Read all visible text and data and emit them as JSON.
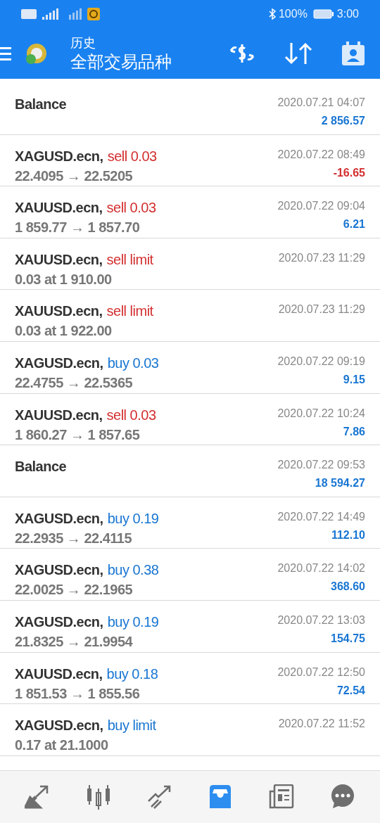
{
  "status_bar": {
    "battery": "100%",
    "time": "3:00"
  },
  "header": {
    "title": "历史",
    "subtitle": "全部交易品种"
  },
  "rows": [
    {
      "kind": "balance",
      "title": "Balance",
      "time": "2020.07.21 04:07",
      "profit": {
        "text": "2 856.57",
        "color": "#1976d2"
      }
    },
    {
      "kind": "trade",
      "title": "XAGUSD.ecn,",
      "action": {
        "text": "sell 0.03",
        "color": "#d32f2f"
      },
      "detail": "22.4095 → 22.5205",
      "time": "2020.07.22 08:49",
      "profit": {
        "text": "-16.65",
        "color": "#d32f2f"
      }
    },
    {
      "kind": "trade",
      "title": "XAUUSD.ecn,",
      "action": {
        "text": "sell 0.03",
        "color": "#d32f2f"
      },
      "detail": "1 859.77 → 1 857.70",
      "time": "2020.07.22 09:04",
      "profit": {
        "text": "6.21",
        "color": "#1976d2"
      }
    },
    {
      "kind": "trade",
      "title": "XAUUSD.ecn,",
      "action": {
        "text": "sell limit",
        "color": "#d32f2f"
      },
      "detail": "0.03 at 1 910.00",
      "time": "2020.07.23 11:29"
    },
    {
      "kind": "trade",
      "title": "XAUUSD.ecn,",
      "action": {
        "text": "sell limit",
        "color": "#d32f2f"
      },
      "detail": "0.03 at 1 922.00",
      "time": "2020.07.23 11:29"
    },
    {
      "kind": "trade",
      "title": "XAGUSD.ecn,",
      "action": {
        "text": "buy 0.03",
        "color": "#1976d2"
      },
      "detail": "22.4755 → 22.5365",
      "time": "2020.07.22 09:19",
      "profit": {
        "text": "9.15",
        "color": "#1976d2"
      }
    },
    {
      "kind": "trade",
      "title": "XAUUSD.ecn,",
      "action": {
        "text": "sell 0.03",
        "color": "#d32f2f"
      },
      "detail": "1 860.27 → 1 857.65",
      "time": "2020.07.22 10:24",
      "profit": {
        "text": "7.86",
        "color": "#1976d2"
      }
    },
    {
      "kind": "balance",
      "title": "Balance",
      "time": "2020.07.22 09:53",
      "profit": {
        "text": "18 594.27",
        "color": "#1976d2"
      }
    },
    {
      "kind": "trade",
      "title": "XAGUSD.ecn,",
      "action": {
        "text": "buy 0.19",
        "color": "#1976d2"
      },
      "detail": "22.2935 → 22.4115",
      "time": "2020.07.22 14:49",
      "profit": {
        "text": "112.10",
        "color": "#1976d2"
      }
    },
    {
      "kind": "trade",
      "title": "XAGUSD.ecn,",
      "action": {
        "text": "buy 0.38",
        "color": "#1976d2"
      },
      "detail": "22.0025 → 22.1965",
      "time": "2020.07.22 14:02",
      "profit": {
        "text": "368.60",
        "color": "#1976d2"
      }
    },
    {
      "kind": "trade",
      "title": "XAGUSD.ecn,",
      "action": {
        "text": "buy 0.19",
        "color": "#1976d2"
      },
      "detail": "21.8325 → 21.9954",
      "time": "2020.07.22 13:03",
      "profit": {
        "text": "154.75",
        "color": "#1976d2"
      }
    },
    {
      "kind": "trade",
      "title": "XAUUSD.ecn,",
      "action": {
        "text": "buy 0.18",
        "color": "#1976d2"
      },
      "detail": "1 851.53 → 1 855.56",
      "time": "2020.07.22 12:50",
      "profit": {
        "text": "72.54",
        "color": "#1976d2"
      }
    },
    {
      "kind": "trade",
      "title": "XAGUSD.ecn,",
      "action": {
        "text": "buy limit",
        "color": "#1976d2"
      },
      "detail": "0.17 at 21.1000",
      "time": "2020.07.22 11:52"
    }
  ],
  "nav": [
    {
      "kind": "trade",
      "selected": false
    },
    {
      "kind": "candles",
      "selected": false
    },
    {
      "kind": "chart",
      "selected": false
    },
    {
      "kind": "inbox",
      "selected": true
    },
    {
      "kind": "news",
      "selected": false
    },
    {
      "kind": "chat",
      "selected": false
    }
  ]
}
